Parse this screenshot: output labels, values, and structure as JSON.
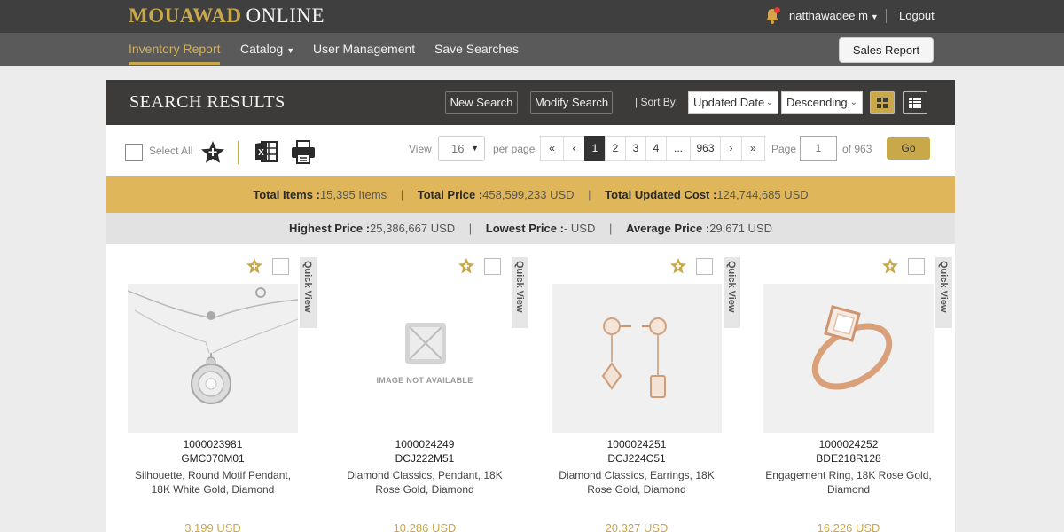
{
  "header": {
    "brand": "MOUAWAD",
    "brand_suffix": "ONLINE",
    "user": "natthawadee m",
    "logout": "Logout"
  },
  "nav": {
    "items": [
      {
        "label": "Inventory Report",
        "active": true
      },
      {
        "label": "Catalog",
        "dropdown": true
      },
      {
        "label": "User Management"
      },
      {
        "label": "Save Searches"
      }
    ],
    "sales_report": "Sales Report"
  },
  "results": {
    "title": "SEARCH RESULTS",
    "new_search": "New Search",
    "modify_search": "Modify Search",
    "sort_by": "| Sort By:",
    "sort_field": "Updated Date",
    "sort_order": "Descending",
    "accent": "#c9a84a"
  },
  "toolbar": {
    "select_all": "Select All",
    "view_label": "View",
    "per_page_value": "16",
    "per_page_label": "per page",
    "pages": [
      "«",
      "‹",
      "1",
      "2",
      "3",
      "4",
      "...",
      "963",
      "›",
      "»"
    ],
    "active_page": "1",
    "page_label": "Page",
    "page_input": "1",
    "of_pages": "of 963",
    "go": "Go"
  },
  "summary": {
    "total_items_label": "Total Items :",
    "total_items": "15,395 Items",
    "total_price_label": "Total Price :",
    "total_price": "458,599,233 USD",
    "total_cost_label": "Total Updated Cost :",
    "total_cost": "124,744,685 USD",
    "highest_label": "Highest Price :",
    "highest": "25,386,667 USD",
    "lowest_label": "Lowest Price :",
    "lowest": "- USD",
    "average_label": "Average Price :",
    "average": "29,671 USD"
  },
  "products": [
    {
      "id": "1000023981",
      "sku": "GMC070M01",
      "desc1": "Silhouette, Round Motif Pendant,",
      "desc2": "18K White Gold, Diamond",
      "price": "3,199 USD",
      "image": "pendant"
    },
    {
      "id": "1000024249",
      "sku": "DCJ222M51",
      "desc1": "Diamond Classics, Pendant, 18K",
      "desc2": "Rose Gold, Diamond",
      "price": "10,286 USD",
      "image": "none",
      "image_text": "IMAGE NOT AVAILABLE"
    },
    {
      "id": "1000024251",
      "sku": "DCJ224C51",
      "desc1": "Diamond Classics, Earrings, 18K",
      "desc2": "Rose Gold, Diamond",
      "price": "20,327 USD",
      "image": "earrings"
    },
    {
      "id": "1000024252",
      "sku": "BDE218R128",
      "desc1": "Engagement Ring, 18K Rose Gold,",
      "desc2": "Diamond",
      "price": "16,226 USD",
      "image": "ring"
    }
  ],
  "quick_view": "Quick View"
}
